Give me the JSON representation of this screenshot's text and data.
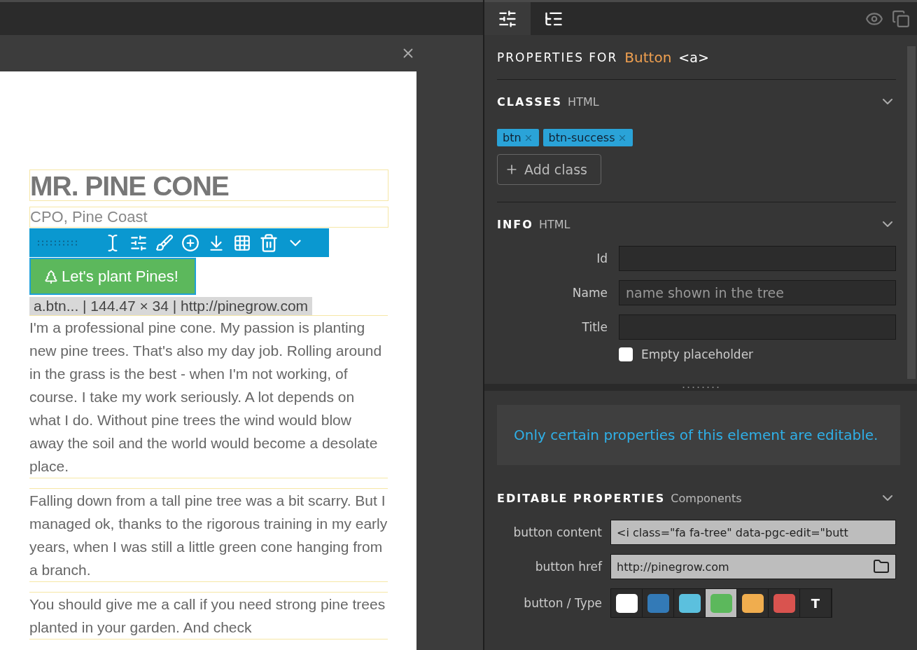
{
  "canvas": {
    "heading": "MR. PINE CONE",
    "subtitle": "CPO, Pine Coast",
    "button_label": "Let's plant Pines!",
    "element_info": "a.btn... | 144.47 × 34 | http://pinegrow.com",
    "paragraphs": [
      "I'm a professional pine cone. My passion is planting new pine trees. That's also my day job. Rolling around in the grass is the best - when I'm not working, of course. I take my work seriously. A lot depends on what I do. Without pine trees the wind would blow away the soil and the world would become a desolate place.",
      "Falling down from a tall pine tree was a bit scarry. But I managed ok, thanks to the rigorous training in my early years, when I was still a little green cone hanging from a branch.",
      "You should give me a call if you need strong pine trees planted in your garden. And check"
    ]
  },
  "panel": {
    "tabs": [
      {
        "kind": "properties",
        "selected": true
      },
      {
        "kind": "tree",
        "selected": false
      }
    ],
    "header": {
      "label": "PROPERTIES FOR",
      "element": "Button",
      "tag": "<a>"
    },
    "classes": {
      "title": "CLASSES",
      "subtitle": "HTML",
      "expanded": true,
      "tags": [
        "btn",
        "btn-success"
      ],
      "add_label": "Add class"
    },
    "info": {
      "title": "INFO",
      "subtitle": "HTML",
      "expanded": true,
      "fields": [
        {
          "label": "Id"
        },
        {
          "label": "Name",
          "placeholder": "name shown in the tree"
        },
        {
          "label": "Title"
        }
      ],
      "checkbox": {
        "label": "Empty placeholder",
        "checked": false
      }
    },
    "notice": "Only certain properties of this element are editable.",
    "editable": {
      "title": "EDITABLE PROPERTIES",
      "subtitle": "Components",
      "expanded": true,
      "content": {
        "label": "button content",
        "value": "<i class=\"fa fa-tree\" data-pgc-edit=\"butt"
      },
      "href": {
        "label": "button href",
        "value": "http://pinegrow.com"
      },
      "type": {
        "label": "button / Type",
        "options": [
          {
            "kind": "swatch",
            "color": "#ffffff",
            "selected": false
          },
          {
            "kind": "swatch",
            "color": "#337ab7",
            "selected": false
          },
          {
            "kind": "swatch",
            "color": "#5bc0de",
            "selected": false
          },
          {
            "kind": "swatch",
            "color": "#5cb85c",
            "selected": true
          },
          {
            "kind": "swatch",
            "color": "#f0ad4e",
            "selected": false
          },
          {
            "kind": "swatch",
            "color": "#d9534f",
            "selected": false
          },
          {
            "kind": "text",
            "label": "T",
            "selected": false
          }
        ]
      }
    }
  }
}
